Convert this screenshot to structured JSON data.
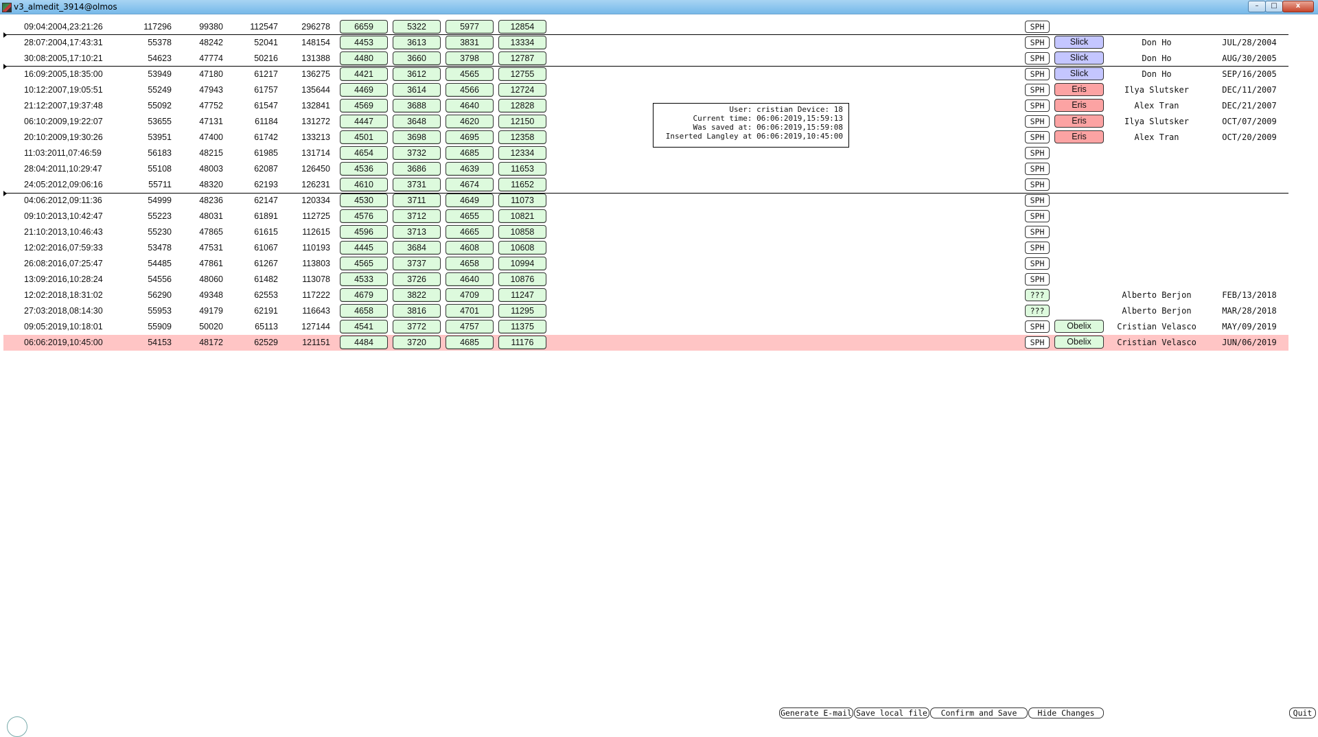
{
  "window": {
    "title": "v3_almedit_3914@olmos",
    "min_label": "–",
    "max_label": "□",
    "close_label": "x"
  },
  "rows": [
    {
      "time": "09:04:2004,23:21:26",
      "n1": "117296",
      "n2": "99380",
      "n3": "112547",
      "n4": "296278",
      "g1": "6659",
      "g2": "5322",
      "g3": "5977",
      "g4": "12854",
      "sph": "SPH",
      "tag": "",
      "tag_type": "",
      "user": "",
      "date": ""
    },
    {
      "time": "28:07:2004,17:43:31",
      "n1": "55378",
      "n2": "48242",
      "n3": "52041",
      "n4": "148154",
      "g1": "4453",
      "g2": "3613",
      "g3": "3831",
      "g4": "13334",
      "sph": "SPH",
      "tag": "Slick",
      "tag_type": "slick",
      "user": "Don Ho",
      "date": "JUL/28/2004"
    },
    {
      "time": "30:08:2005,17:10:21",
      "n1": "54623",
      "n2": "47774",
      "n3": "50216",
      "n4": "131388",
      "g1": "4480",
      "g2": "3660",
      "g3": "3798",
      "g4": "12787",
      "sph": "SPH",
      "tag": "Slick",
      "tag_type": "slick",
      "user": "Don Ho",
      "date": "AUG/30/2005"
    },
    {
      "time": "16:09:2005,18:35:00",
      "n1": "53949",
      "n2": "47180",
      "n3": "61217",
      "n4": "136275",
      "g1": "4421",
      "g2": "3612",
      "g3": "4565",
      "g4": "12755",
      "sph": "SPH",
      "tag": "Slick",
      "tag_type": "slick",
      "user": "Don Ho",
      "date": "SEP/16/2005"
    },
    {
      "time": "10:12:2007,19:05:51",
      "n1": "55249",
      "n2": "47943",
      "n3": "61757",
      "n4": "135644",
      "g1": "4469",
      "g2": "3614",
      "g3": "4566",
      "g4": "12724",
      "sph": "SPH",
      "tag": "Eris",
      "tag_type": "eris",
      "user": "Ilya Slutsker",
      "date": "DEC/11/2007"
    },
    {
      "time": "21:12:2007,19:37:48",
      "n1": "55092",
      "n2": "47752",
      "n3": "61547",
      "n4": "132841",
      "g1": "4569",
      "g2": "3688",
      "g3": "4640",
      "g4": "12828",
      "sph": "SPH",
      "tag": "Eris",
      "tag_type": "eris",
      "user": "Alex Tran",
      "date": "DEC/21/2007"
    },
    {
      "time": "06:10:2009,19:22:07",
      "n1": "53655",
      "n2": "47131",
      "n3": "61184",
      "n4": "131272",
      "g1": "4447",
      "g2": "3648",
      "g3": "4620",
      "g4": "12150",
      "sph": "SPH",
      "tag": "Eris",
      "tag_type": "eris",
      "user": "Ilya Slutsker",
      "date": "OCT/07/2009"
    },
    {
      "time": "20:10:2009,19:30:26",
      "n1": "53951",
      "n2": "47400",
      "n3": "61742",
      "n4": "133213",
      "g1": "4501",
      "g2": "3698",
      "g3": "4695",
      "g4": "12358",
      "sph": "SPH",
      "tag": "Eris",
      "tag_type": "eris",
      "user": "Alex Tran",
      "date": "OCT/20/2009"
    },
    {
      "time": "11:03:2011,07:46:59",
      "n1": "56183",
      "n2": "48215",
      "n3": "61985",
      "n4": "131714",
      "g1": "4654",
      "g2": "3732",
      "g3": "4685",
      "g4": "12334",
      "sph": "SPH",
      "tag": "",
      "tag_type": "",
      "user": "",
      "date": ""
    },
    {
      "time": "28:04:2011,10:29:47",
      "n1": "55108",
      "n2": "48003",
      "n3": "62087",
      "n4": "126450",
      "g1": "4536",
      "g2": "3686",
      "g3": "4639",
      "g4": "11653",
      "sph": "SPH",
      "tag": "",
      "tag_type": "",
      "user": "",
      "date": ""
    },
    {
      "time": "24:05:2012,09:06:16",
      "n1": "55711",
      "n2": "48320",
      "n3": "62193",
      "n4": "126231",
      "g1": "4610",
      "g2": "3731",
      "g3": "4674",
      "g4": "11652",
      "sph": "SPH",
      "tag": "",
      "tag_type": "",
      "user": "",
      "date": ""
    },
    {
      "time": "04:06:2012,09:11:36",
      "n1": "54999",
      "n2": "48236",
      "n3": "62147",
      "n4": "120334",
      "g1": "4530",
      "g2": "3711",
      "g3": "4649",
      "g4": "11073",
      "sph": "SPH",
      "tag": "",
      "tag_type": "",
      "user": "",
      "date": ""
    },
    {
      "time": "09:10:2013,10:42:47",
      "n1": "55223",
      "n2": "48031",
      "n3": "61891",
      "n4": "112725",
      "g1": "4576",
      "g2": "3712",
      "g3": "4655",
      "g4": "10821",
      "sph": "SPH",
      "tag": "",
      "tag_type": "",
      "user": "",
      "date": ""
    },
    {
      "time": "21:10:2013,10:46:43",
      "n1": "55230",
      "n2": "47865",
      "n3": "61615",
      "n4": "112615",
      "g1": "4596",
      "g2": "3713",
      "g3": "4665",
      "g4": "10858",
      "sph": "SPH",
      "tag": "",
      "tag_type": "",
      "user": "",
      "date": ""
    },
    {
      "time": "12:02:2016,07:59:33",
      "n1": "53478",
      "n2": "47531",
      "n3": "61067",
      "n4": "110193",
      "g1": "4445",
      "g2": "3684",
      "g3": "4608",
      "g4": "10608",
      "sph": "SPH",
      "tag": "",
      "tag_type": "",
      "user": "",
      "date": ""
    },
    {
      "time": "26:08:2016,07:25:47",
      "n1": "54485",
      "n2": "47861",
      "n3": "61267",
      "n4": "113803",
      "g1": "4565",
      "g2": "3737",
      "g3": "4658",
      "g4": "10994",
      "sph": "SPH",
      "tag": "",
      "tag_type": "",
      "user": "",
      "date": ""
    },
    {
      "time": "13:09:2016,10:28:24",
      "n1": "54556",
      "n2": "48060",
      "n3": "61482",
      "n4": "113078",
      "g1": "4533",
      "g2": "3726",
      "g3": "4640",
      "g4": "10876",
      "sph": "SPH",
      "tag": "",
      "tag_type": "",
      "user": "",
      "date": ""
    },
    {
      "time": "12:02:2018,18:31:02",
      "n1": "56290",
      "n2": "49348",
      "n3": "62553",
      "n4": "117222",
      "g1": "4679",
      "g2": "3822",
      "g3": "4709",
      "g4": "11247",
      "sph": "???",
      "tag": "",
      "tag_type": "",
      "user": "Alberto Berjon",
      "date": "FEB/13/2018"
    },
    {
      "time": "27:03:2018,08:14:30",
      "n1": "55953",
      "n2": "49179",
      "n3": "62191",
      "n4": "116643",
      "g1": "4658",
      "g2": "3816",
      "g3": "4701",
      "g4": "11295",
      "sph": "???",
      "tag": "",
      "tag_type": "",
      "user": "Alberto Berjon",
      "date": "MAR/28/2018"
    },
    {
      "time": "09:05:2019,10:18:01",
      "n1": "55909",
      "n2": "50020",
      "n3": "65113",
      "n4": "127144",
      "g1": "4541",
      "g2": "3772",
      "g3": "4757",
      "g4": "11375",
      "sph": "SPH",
      "tag": "Obelix",
      "tag_type": "obelix",
      "user": "Cristian Velasco",
      "date": "MAY/09/2019"
    },
    {
      "time": "06:06:2019,10:45:00",
      "n1": "54153",
      "n2": "48172",
      "n3": "62529",
      "n4": "121151",
      "g1": "4484",
      "g2": "3720",
      "g3": "4685",
      "g4": "11176",
      "sph": "SPH",
      "tag": "Obelix",
      "tag_type": "obelix",
      "user": "Cristian Velasco",
      "date": "JUN/06/2019",
      "highlight": true
    }
  ],
  "info": {
    "line1": "User: cristian Device: 18",
    "line2": "Current time: 06:06:2019,15:59:13",
    "line3": "Was saved at: 06:06:2019,15:59:08",
    "line4": "Inserted Langley at 06:06:2019,10:45:00"
  },
  "buttons": {
    "email": "Generate E-mail",
    "save_local": "Save local file",
    "confirm": "Confirm and Save",
    "hide": "Hide Changes",
    "quit": "Quit"
  },
  "colors": {
    "green_cell": "#ddfadd",
    "slick": "#c4c6ff",
    "eris": "#fca3a3",
    "highlight_row": "#ffc5c5"
  }
}
